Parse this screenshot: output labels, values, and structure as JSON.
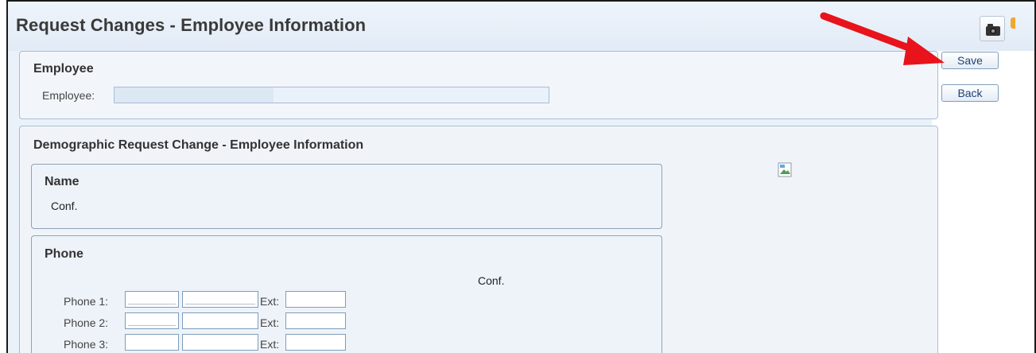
{
  "window": {
    "title": "Request Changes - Employee Information",
    "toolbar_icons": [
      "camera-icon"
    ]
  },
  "actions": {
    "save_label": "Save",
    "back_label": "Back"
  },
  "employee_section": {
    "title": "Employee",
    "employee_label": "Employee:",
    "employee_value": ""
  },
  "demographic_section": {
    "title": "Demographic Request Change - Employee Information",
    "name_panel": {
      "title": "Name",
      "conf_label": "Conf."
    },
    "phone_panel": {
      "title": "Phone",
      "conf_label": "Conf.",
      "ext_label": "Ext:",
      "rows": [
        {
          "label": "Phone 1:",
          "area": "",
          "number": "",
          "ext": ""
        },
        {
          "label": "Phone 2:",
          "area": "",
          "number": "",
          "ext": ""
        },
        {
          "label": "Phone 3:",
          "area": "",
          "number": "",
          "ext": ""
        }
      ]
    }
  },
  "colors": {
    "annotation_arrow": "#e8131b",
    "panel_border": "#a9bdd3",
    "link_text": "#1e3f7a"
  }
}
